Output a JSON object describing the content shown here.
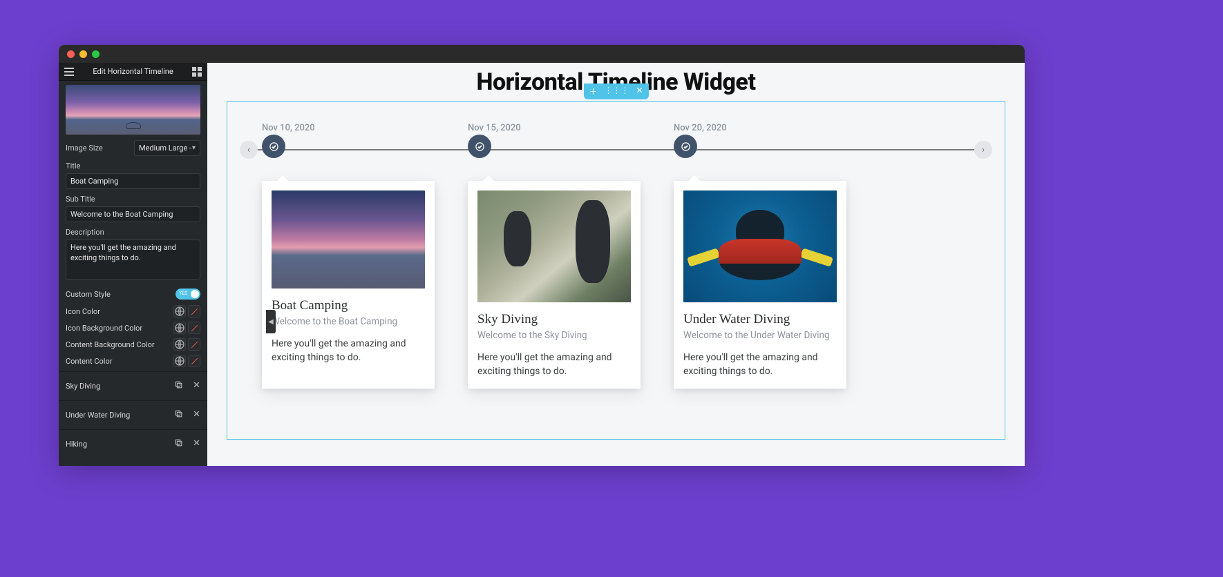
{
  "sidebar": {
    "header_title": "Edit Horizontal Timeline",
    "image_size_label": "Image Size",
    "image_size_value": "Medium Large -",
    "title_label": "Title",
    "title_value": "Boat Camping",
    "subtitle_label": "Sub Title",
    "subtitle_value": "Welcome to the Boat Camping",
    "description_label": "Description",
    "description_value": "Here you'll get the amazing and exciting things to do.",
    "custom_style_label": "Custom Style",
    "custom_style_toggle_text": "YES",
    "color_rows": [
      {
        "label": "Icon Color"
      },
      {
        "label": "Icon Background Color"
      },
      {
        "label": "Content Background Color"
      },
      {
        "label": "Content Color"
      }
    ],
    "items": [
      {
        "label": "Sky Diving"
      },
      {
        "label": "Under Water Diving"
      },
      {
        "label": "Hiking"
      }
    ]
  },
  "preview": {
    "page_title": "Horizontal Timeline Widget",
    "events": [
      {
        "date": "Nov 10, 2020",
        "title": "Boat Camping",
        "subtitle": "Welcome to the Boat Camping",
        "desc": "Here you'll get the amazing and exciting things to do.",
        "img_class": "boat"
      },
      {
        "date": "Nov 15, 2020",
        "title": "Sky Diving",
        "subtitle": "Welcome to the Sky Diving",
        "desc": "Here you'll get the amazing and exciting things to do.",
        "img_class": "sky"
      },
      {
        "date": "Nov 20, 2020",
        "title": "Under Water Diving",
        "subtitle": "Welcome to the Under Water Diving",
        "desc": "Here you'll get the amazing and exciting things to do.",
        "img_class": "water"
      }
    ]
  }
}
